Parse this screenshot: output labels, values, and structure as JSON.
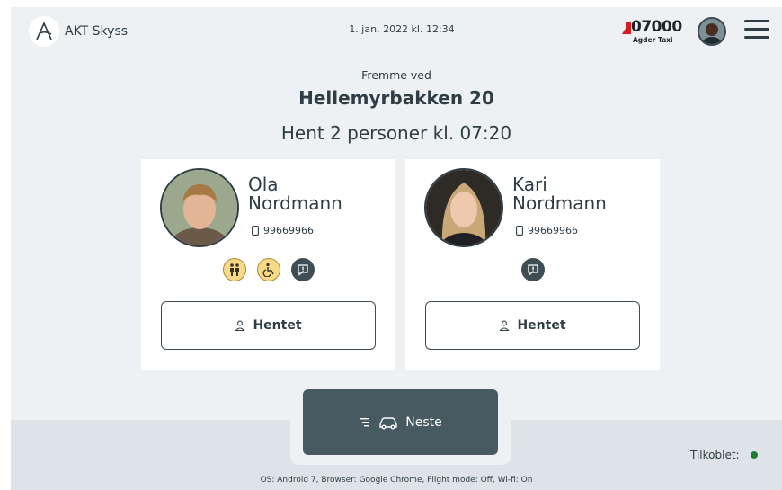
{
  "header": {
    "app_name": "AKT Skyss",
    "datetime": "1. jan. 2022 kl. 12:34",
    "vehicle_id": "07000",
    "company": "Agder Taxi"
  },
  "trip": {
    "arrival_label": "Fremme ved",
    "address": "Hellemyrbakken 20",
    "pickup_text": "Hent 2 personer kl. 07:20"
  },
  "passengers": [
    {
      "first_name": "Ola",
      "last_name": "Nordmann",
      "phone": "99669966",
      "icons": [
        "companion-icon",
        "wheelchair-icon",
        "message-icon"
      ],
      "button_label": "Hentet"
    },
    {
      "first_name": "Kari",
      "last_name": "Nordmann",
      "phone": "99669966",
      "icons": [
        "message-icon"
      ],
      "button_label": "Hentet"
    }
  ],
  "footer": {
    "next_label": "Neste",
    "connected_label": "Tilkoblet:",
    "system_info": "OS: Android 7, Browser: Google Chrome, Flight mode: Off, Wi-fi: On"
  },
  "colors": {
    "accent": "#475a61",
    "background": "#eef1f3",
    "badge_yellow": "#f7d98a",
    "status_connected": "#1e7d33",
    "brand_red": "#d71920"
  }
}
